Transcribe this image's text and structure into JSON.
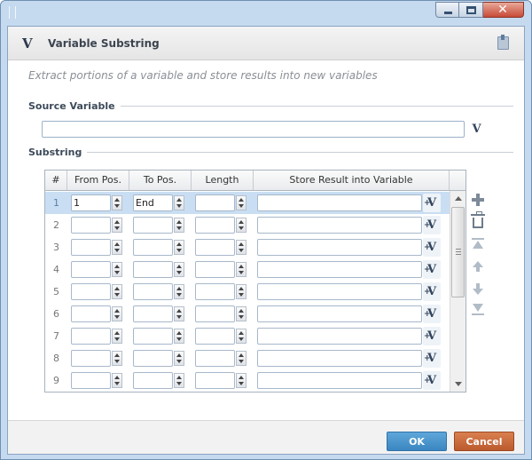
{
  "window": {
    "minimize_icon": "minimize-icon",
    "maximize_icon": "maximize-icon",
    "close_glyph": "✕"
  },
  "header": {
    "logo": "V",
    "title": "Variable Substring",
    "help_icon": "book-icon"
  },
  "description": "Extract portions of  a variable and store results into new variables",
  "source_variable": {
    "label": "Source Variable",
    "value": "",
    "button_label": "V"
  },
  "substring": {
    "label": "Substring",
    "columns": [
      "#",
      "From Pos.",
      "To Pos.",
      "Length",
      "Store Result into Variable"
    ],
    "rows": [
      {
        "num": "1",
        "from": "1",
        "to": "End",
        "length": "",
        "store": "",
        "selected": true
      },
      {
        "num": "2",
        "from": "",
        "to": "",
        "length": "",
        "store": ""
      },
      {
        "num": "3",
        "from": "",
        "to": "",
        "length": "",
        "store": ""
      },
      {
        "num": "4",
        "from": "",
        "to": "",
        "length": "",
        "store": ""
      },
      {
        "num": "5",
        "from": "",
        "to": "",
        "length": "",
        "store": ""
      },
      {
        "num": "6",
        "from": "",
        "to": "",
        "length": "",
        "store": ""
      },
      {
        "num": "7",
        "from": "",
        "to": "",
        "length": "",
        "store": ""
      },
      {
        "num": "8",
        "from": "",
        "to": "",
        "length": "",
        "store": ""
      },
      {
        "num": "9",
        "from": "",
        "to": "",
        "length": "",
        "store": ""
      }
    ],
    "row_button_label": "V",
    "row_button_arrow": "+",
    "tools": [
      "add-icon",
      "delete-icon",
      "move-top-icon",
      "move-up-icon",
      "move-down-icon",
      "move-bottom-icon"
    ]
  },
  "footer": {
    "ok_label": "OK",
    "cancel_label": "Cancel"
  },
  "colors": {
    "ok": "#3b86c1",
    "cancel": "#bb5a2e",
    "selected_row": "#c9def2"
  }
}
